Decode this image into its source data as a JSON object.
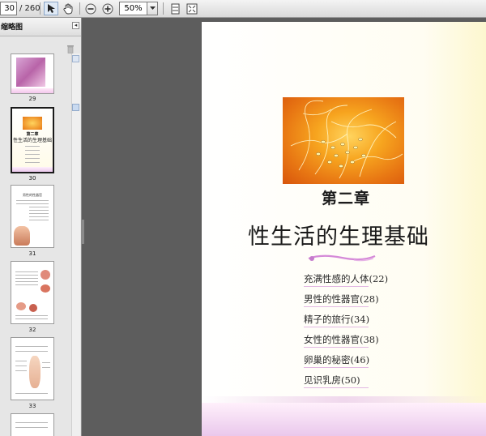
{
  "toolbar": {
    "current_page": "30",
    "page_total": "/ 260",
    "zoom": "50%",
    "icons": [
      "select-tool-icon",
      "hand-tool-icon",
      "zoom-out-icon",
      "zoom-in-icon",
      "fit-width-icon",
      "fit-page-icon"
    ]
  },
  "sidebar": {
    "title": "缩略图",
    "thumbnails": [
      {
        "label": "29"
      },
      {
        "label": "30",
        "selected": true,
        "lines": [
          "第二章",
          "性生活的生理基础"
        ]
      },
      {
        "label": "31",
        "lines": [
          "男性的性器官"
        ]
      },
      {
        "label": "32"
      },
      {
        "label": "33"
      }
    ]
  },
  "page": {
    "chapter": "第二章",
    "title": "性生活的生理基础",
    "toc": [
      "充满性感的人体(22)",
      "男性的性器官(28)",
      "精子的旅行(34)",
      "女性的性器官(38)",
      "卵巢的秘密(46)",
      "见识乳房(50)"
    ]
  },
  "colors": {
    "accent": "#f7a51f",
    "viewer_bg": "#5d5d5d",
    "ornament": "#d58ad8"
  }
}
